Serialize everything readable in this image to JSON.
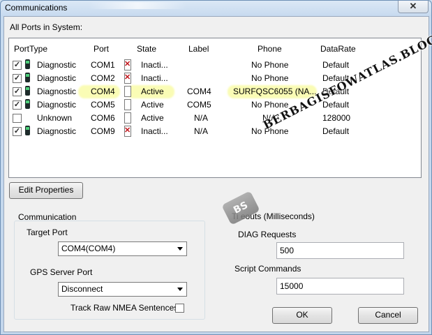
{
  "window": {
    "title": "Communications",
    "close_glyph": "✕"
  },
  "ports": {
    "section_label": "All Ports in System:",
    "columns": [
      "PortType",
      "Port",
      "State",
      "Label",
      "Phone",
      "DataRate"
    ],
    "rows": [
      {
        "checked": true,
        "icon": "phone-icon",
        "port_type": "Diagnostic",
        "port": "COM1",
        "state_icon": "inactive-x-icon",
        "state": "Inacti...",
        "label": "",
        "phone": "No Phone",
        "data_rate": "Default"
      },
      {
        "checked": true,
        "icon": "phone-icon",
        "port_type": "Diagnostic",
        "port": "COM2",
        "state_icon": "inactive-x-icon",
        "state": "Inacti...",
        "label": "",
        "phone": "No Phone",
        "data_rate": "Default"
      },
      {
        "checked": true,
        "icon": "phone-icon",
        "port_type": "Diagnostic",
        "port": "COM4",
        "state_icon": "active-icon",
        "state": "Active",
        "label": "COM4",
        "phone": "SURFQSC6055 (NA...",
        "data_rate": "Default"
      },
      {
        "checked": true,
        "icon": "phone-icon",
        "port_type": "Diagnostic",
        "port": "COM5",
        "state_icon": "active-icon",
        "state": "Active",
        "label": "COM5",
        "phone": "No Phone",
        "data_rate": "Default"
      },
      {
        "checked": false,
        "icon": "",
        "port_type": "Unknown",
        "port": "COM6",
        "state_icon": "active-icon",
        "state": "Active",
        "label": "N/A",
        "phone": "N/A",
        "data_rate": "128000"
      },
      {
        "checked": true,
        "icon": "phone-icon",
        "port_type": "Diagnostic",
        "port": "COM9",
        "state_icon": "inactive-x-icon",
        "state": "Inacti...",
        "label": "N/A",
        "phone": "No Phone",
        "data_rate": "Default"
      }
    ],
    "highlight_color": "#f5fa78"
  },
  "edit_properties_label": "Edit Properties",
  "communication": {
    "group_label": "Communication",
    "target_port_label": "Target Port",
    "target_port_value": "COM4(COM4)",
    "gps_label": "GPS Server Port",
    "gps_value": "Disconnect",
    "track_nmea_label": "Track Raw NMEA Sentences"
  },
  "timeouts": {
    "group_label": "Timeouts (Milliseconds)",
    "group_label_visible": "Ti    eouts (Milliseconds)",
    "diag_label": "DIAG Requests",
    "diag_value": "500",
    "script_label": "Script Commands",
    "script_value": "15000"
  },
  "buttons": {
    "ok": "OK",
    "cancel": "Cancel"
  },
  "watermark": {
    "text": "BERBAGISFOWATLAS.BLOGSPOT.COM",
    "logo": "BS"
  }
}
